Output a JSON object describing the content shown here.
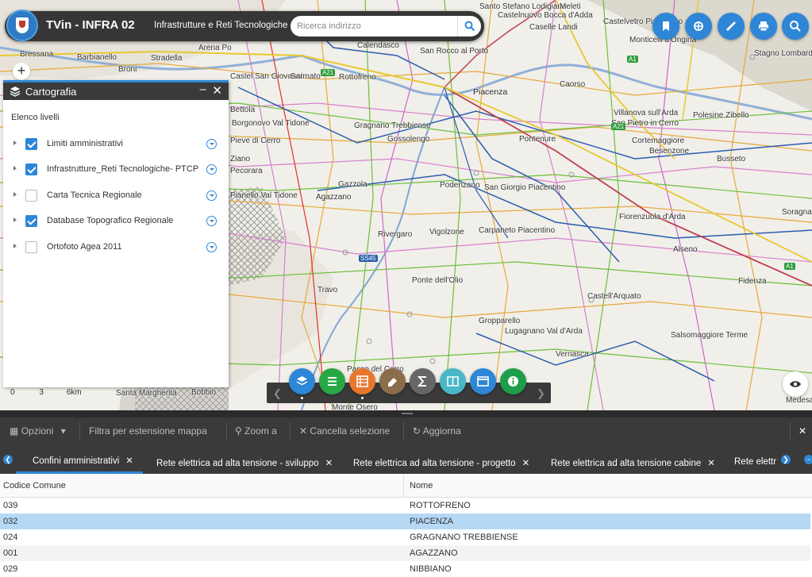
{
  "header": {
    "title": "TVin - INFRA 02",
    "subtitle": "Infrastrutture e Reti Tecnologiche",
    "search_placeholder": "Ricerca indirizzo"
  },
  "map": {
    "places": [
      "Santo Stefano Lodigiano",
      "Meleti",
      "Castelnuovo Bocca d'Adda",
      "Caselle Landi",
      "Castelvetro Piacentino",
      "Monticelli d'Ongina",
      "Stagno Lombardo",
      "Bressana",
      "Barbianello",
      "Stradella",
      "Broni",
      "Arena Po",
      "Calendasco",
      "San Rocco al Porto",
      "Rottofreno",
      "Piacenza",
      "Caorso",
      "Villanova sull'Arda",
      "Polesine Zibello",
      "Gragnano Trebbiense",
      "Gossolengo",
      "Podenzano",
      "San Giorgio Piacentino",
      "Pontenure",
      "Cortemaggiore",
      "Besenzone",
      "Busseto",
      "Fiorenzuola d'Arda",
      "Gazzola",
      "Agazzano",
      "Rivergaro",
      "Vigolzone",
      "Carpaneto Piacentino",
      "Alseno",
      "Fidenza",
      "Ponte dell'Olio",
      "Travo",
      "Castell'Arquato",
      "Gropparello",
      "Lugagnano Val d'Arda",
      "Vernasca",
      "Salsomaggiore Terme",
      "Soragna",
      "Pianello Val Tidone",
      "Borgonovo Val Tidone",
      "Castel San Giovanni",
      "Sarmato",
      "San Pietro in Cerro",
      "Santa Margherita",
      "Bobbio",
      "Medesano",
      "Pieve di Cerro",
      "Bettola",
      "Monte Osero",
      "Passo del Cerro",
      "Pecorara",
      "Ziano"
    ],
    "road_labels": [
      "A21",
      "A1",
      "SS45",
      "A21",
      "A1"
    ],
    "scale_labels": [
      "0",
      "3",
      "6km"
    ]
  },
  "panel": {
    "title": "Cartografia",
    "minimize_label": "–",
    "close_label": "✕",
    "list_title": "Elenco livelli",
    "layers": [
      {
        "name": "Limiti amministrativi",
        "checked": true
      },
      {
        "name": "Infrastrutture_Reti Tecnologiche- PTCP",
        "checked": true
      },
      {
        "name": "Carta Tecnica Regionale",
        "checked": false
      },
      {
        "name": "Database Topografico Regionale",
        "checked": true
      },
      {
        "name": "Ortofoto Agea 2011",
        "checked": false
      }
    ]
  },
  "toolbar": {
    "options": "Opzioni",
    "filter": "Filtra per estensione mappa",
    "zoom": "Zoom a",
    "clear": "Cancella selezione",
    "refresh": "Aggiorna",
    "close": "✕"
  },
  "tabs": [
    {
      "label": "Confini amministrativi",
      "active": true
    },
    {
      "label": "Rete elettrica ad alta tensione - sviluppo",
      "active": false
    },
    {
      "label": "Rete elettrica ad alta tensione - progetto",
      "active": false
    },
    {
      "label": "Rete elettrica ad alta tensione cabine",
      "active": false
    },
    {
      "label": "Rete elettr",
      "active": false
    }
  ],
  "grid": {
    "columns": [
      "Codice Comune",
      "Nome"
    ],
    "rows": [
      [
        "039",
        "ROTTOFRENO"
      ],
      [
        "032",
        "PIACENZA"
      ],
      [
        "024",
        "GRAGNANO TREBBIENSE"
      ],
      [
        "001",
        "AGAZZANO"
      ],
      [
        "029",
        "NIBBIANO"
      ]
    ],
    "selected_row": 1
  },
  "colors": {
    "accent": "#2e86d6",
    "dark_bar": "#3a3a3a",
    "layers_btn": "#2e86d6",
    "legend_btn": "#27a844",
    "table_btn": "#e8772e",
    "measure_btn": "#8a6d4b",
    "sum_btn": "#666666",
    "compare_btn": "#4ab7c9",
    "window_btn": "#2e86d6",
    "info_btn": "#1e9e4a",
    "selected_row": "#b5d8f5"
  }
}
